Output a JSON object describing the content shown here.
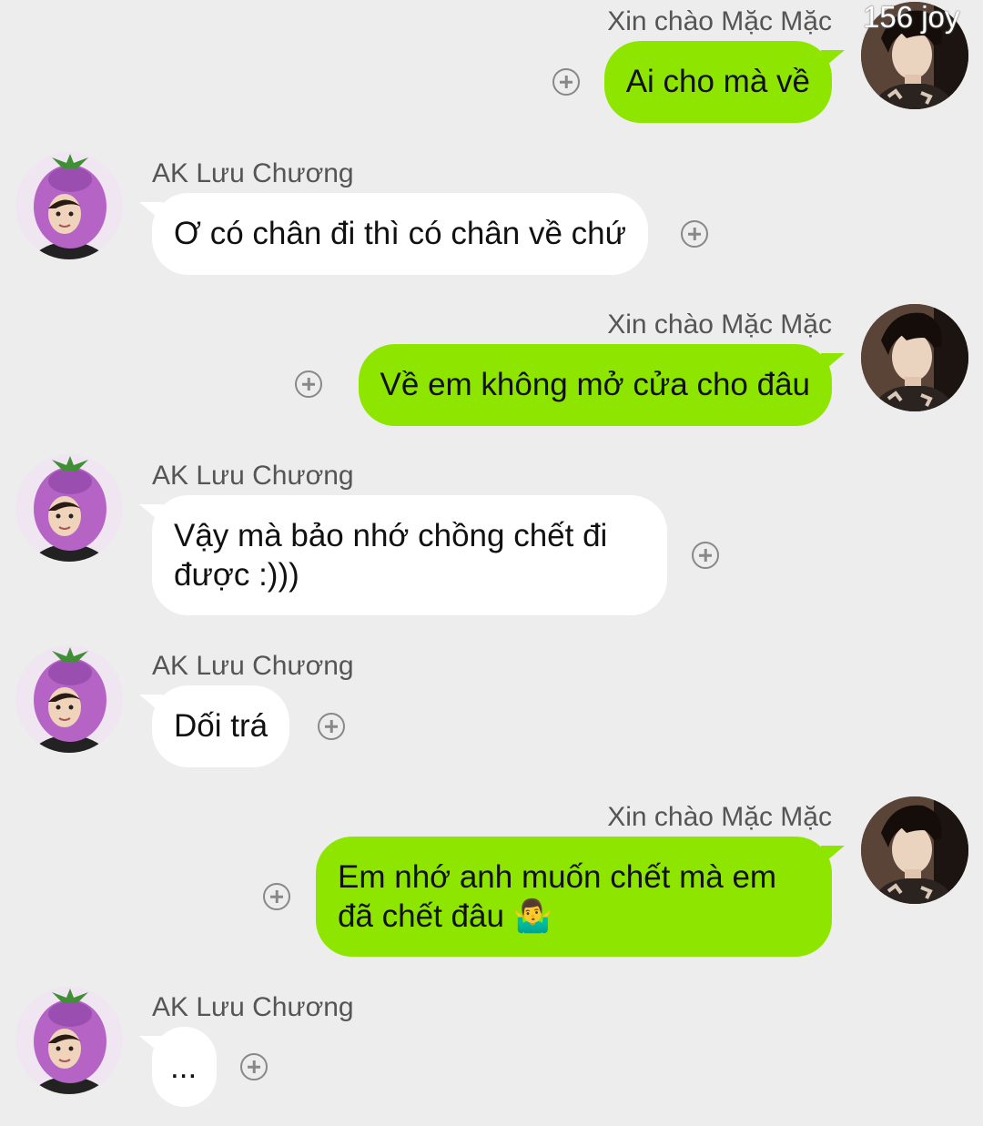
{
  "watermark": "156 joy",
  "messages": [
    {
      "side": "right",
      "sender": "Xin chào Mặc Mặc",
      "text": "Ai cho mà về"
    },
    {
      "side": "left",
      "sender": "AK Lưu Chương",
      "text": "Ơ có chân đi thì có chân về chứ"
    },
    {
      "side": "right",
      "sender": "Xin chào Mặc Mặc",
      "text": "Về em không mở cửa cho đâu"
    },
    {
      "side": "left",
      "sender": "AK Lưu Chương",
      "text_line1": "Vậy mà bảo nhớ chồng chết đi",
      "text_line2": "được :)))"
    },
    {
      "side": "left",
      "sender": "AK Lưu Chương",
      "text": "Dối trá"
    },
    {
      "side": "right",
      "sender": "Xin chào Mặc Mặc",
      "text_line1": "Em nhớ anh muốn chết mà em",
      "text_line2": "đã chết đâu 🤷‍♂️"
    },
    {
      "side": "left",
      "sender": "AK Lưu Chương",
      "text": "..."
    }
  ],
  "icons": {
    "add": "plus-circle-icon",
    "avatar_right": "man-avatar",
    "avatar_left": "eggplant-hat-avatar"
  },
  "colors": {
    "background": "#ededed",
    "outgoing_bubble": "#8ee600",
    "incoming_bubble": "#ffffff"
  }
}
